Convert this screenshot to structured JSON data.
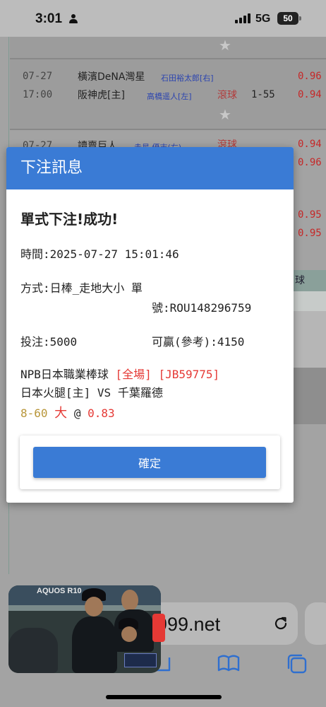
{
  "status_bar": {
    "time": "3:01",
    "network": "5G",
    "battery": "50"
  },
  "background": {
    "game1": {
      "date": "07-27",
      "time": "17:00",
      "team_away": "橫濱DeNA灣星",
      "pitcher_away": "石田裕太郎[右]",
      "team_home": "阪神虎[主]",
      "pitcher_home": "高橋遥人[左]",
      "live_badge": "滾球",
      "line": "1-55",
      "odds_top": "0.96",
      "odds_bottom": "0.94"
    },
    "game2": {
      "date": "07-27",
      "team_away": "讀賣巨人",
      "pitcher_away": "赤星 優志(右)",
      "live_badge": "滾球",
      "odds_top": "0.94",
      "odds_bottom": "0.96"
    },
    "odds_more": [
      "0.95",
      "0.95"
    ],
    "side_label": "球"
  },
  "modal": {
    "header": "下注訊息",
    "title": "單式下注!成功!",
    "time_label": "時間:",
    "time_value": "2025-07-27 15:01:46",
    "method_label": "方式:",
    "method_value": "日棒_走地大小 單",
    "ticket_label": "號:",
    "ticket_value": "ROU148296759",
    "stake_label": "投注:",
    "stake_value": "5000",
    "win_label": "可贏(參考):",
    "win_value": "4150",
    "league": "NPB日本職業棒球",
    "scope": "[全場]",
    "match_code": "[JB59775]",
    "team_home": "日本火腿[主]",
    "vs": "VS",
    "team_away": "千葉羅德",
    "line": "8-60",
    "pick": "大",
    "at": "@",
    "odds": "0.83",
    "confirm_label": "確定"
  },
  "browser": {
    "url": "999.net"
  },
  "pip": {
    "brand": "AQUOS R10"
  },
  "icons": {
    "reload": "reload-icon",
    "bookmarks": "book-icon",
    "tabs": "tabs-icon",
    "share": "share-icon"
  },
  "colors": {
    "accent": "#3a7bd5",
    "red": "#e53935",
    "gold": "#b8963a"
  }
}
